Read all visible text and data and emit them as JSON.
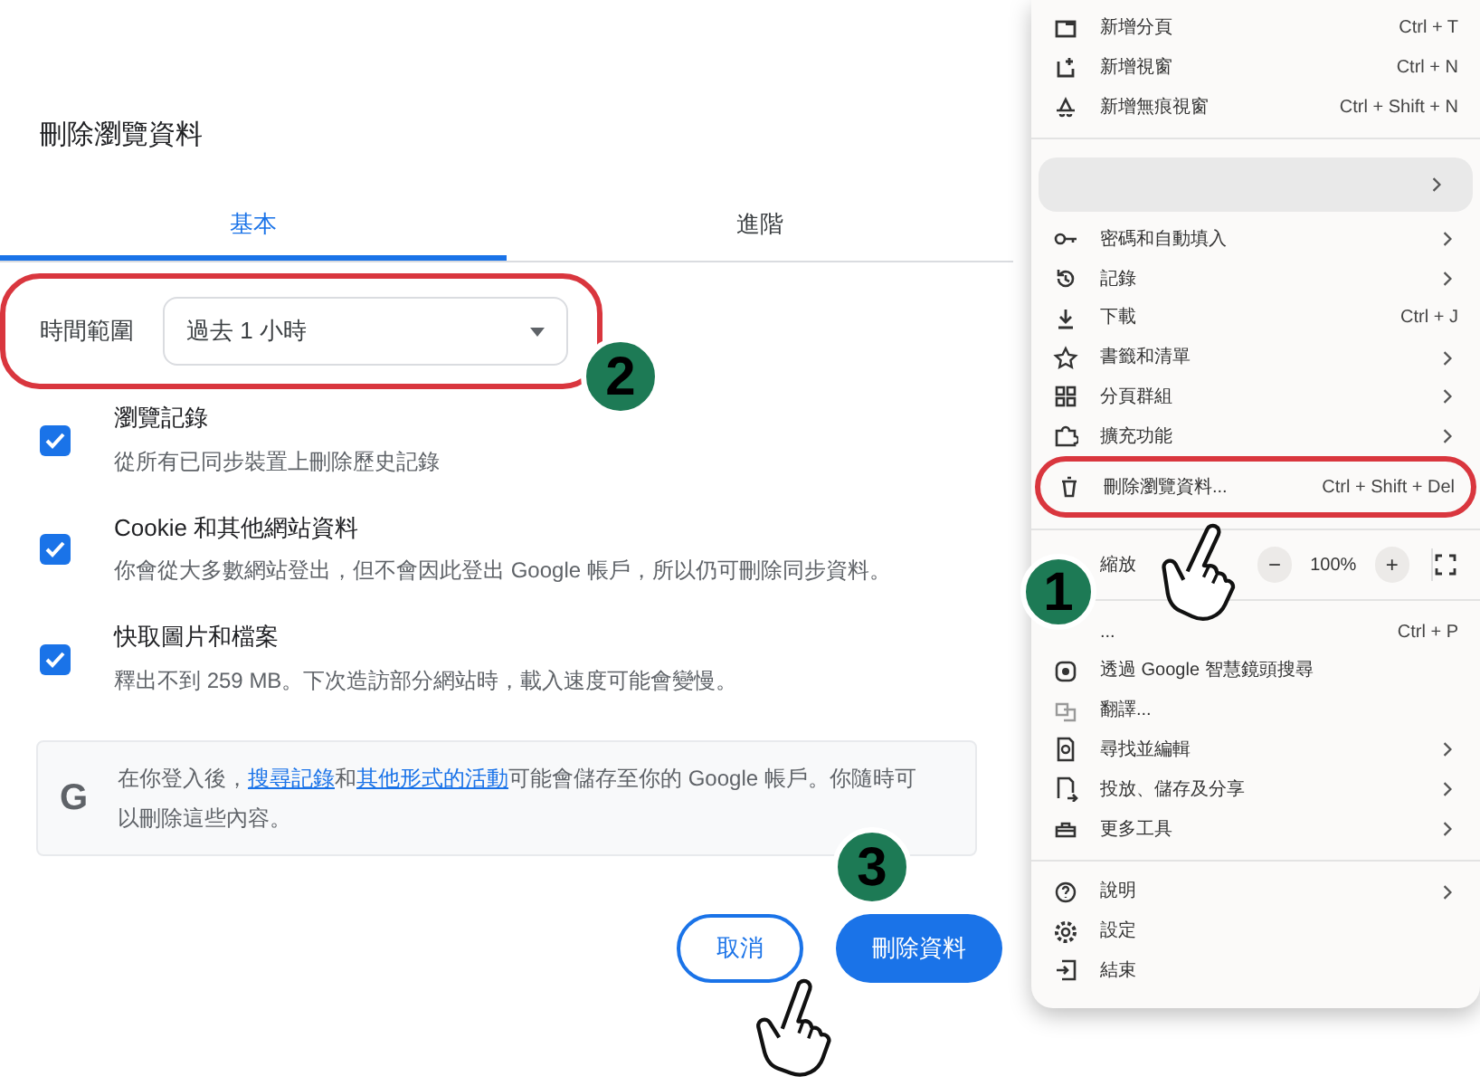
{
  "dialog": {
    "title": "刪除瀏覽資料",
    "tabs": [
      {
        "label": "基本",
        "selected": true
      },
      {
        "label": "進階",
        "selected": false
      }
    ],
    "time_range": {
      "label": "時間範圍",
      "value": "過去 1 小時",
      "highlighted": true
    },
    "options": [
      {
        "title": "瀏覽記錄",
        "description": "從所有已同步裝置上刪除歷史記錄",
        "checked": true
      },
      {
        "title": "Cookie 和其他網站資料",
        "description": "你會從大多數網站登出，但不會因此登出 Google 帳戶，所以仍可刪除同步資料。",
        "checked": true
      },
      {
        "title": "快取圖片和檔案",
        "description": "釋出不到 259 MB。下次造訪部分網站時，載入速度可能會變慢。",
        "checked": true
      }
    ],
    "info_logo": "G",
    "info": [
      {
        "kind": "text",
        "text": "在你登入後，"
      },
      {
        "kind": "link",
        "text": "搜尋記錄"
      },
      {
        "kind": "text",
        "text": "和"
      },
      {
        "kind": "link",
        "text": "其他形式的活動"
      },
      {
        "kind": "text",
        "text": "可能會儲存至你的 Google 帳戶。你隨時可以刪除這些內容。"
      }
    ],
    "buttons": [
      {
        "kind": "cancel",
        "label": "取消"
      },
      {
        "kind": "confirm",
        "label": "刪除資料"
      }
    ]
  },
  "menu": {
    "items": [
      {
        "kind": "item",
        "label": "新增分頁",
        "shortcut": "Ctrl + T",
        "submenu": false
      },
      {
        "kind": "item",
        "label": "新增視窗",
        "shortcut": "Ctrl + N",
        "submenu": false
      },
      {
        "kind": "item",
        "label": "新增無痕視窗",
        "shortcut": "Ctrl + Shift + N",
        "submenu": false
      },
      {
        "kind": "divider"
      },
      {
        "kind": "profile",
        "submenu": true
      },
      {
        "kind": "item",
        "label": "密碼和自動填入",
        "submenu": true
      },
      {
        "kind": "item",
        "label": "記錄",
        "submenu": true
      },
      {
        "kind": "item",
        "label": "下載",
        "shortcut": "Ctrl + J",
        "submenu": false
      },
      {
        "kind": "item",
        "label": "書籤和清單",
        "submenu": true
      },
      {
        "kind": "item",
        "label": "分頁群組",
        "submenu": true
      },
      {
        "kind": "item",
        "label": "擴充功能",
        "submenu": true
      },
      {
        "kind": "item",
        "label": "刪除瀏覽資料...",
        "shortcut": "Ctrl + Shift + Del",
        "submenu": false,
        "highlighted": true
      },
      {
        "kind": "divider"
      },
      {
        "kind": "zoom",
        "label": "縮放",
        "minus": "−",
        "value": "100%",
        "plus": "+"
      },
      {
        "kind": "divider"
      },
      {
        "kind": "item",
        "label": "...",
        "shortcut": "Ctrl + P",
        "submenu": false
      },
      {
        "kind": "item",
        "label": "透過 Google 智慧鏡頭搜尋",
        "submenu": false
      },
      {
        "kind": "item",
        "label": "翻譯...",
        "submenu": false
      },
      {
        "kind": "item",
        "label": "尋找並編輯",
        "submenu": true
      },
      {
        "kind": "item",
        "label": "投放、儲存及分享",
        "submenu": true
      },
      {
        "kind": "item",
        "label": "更多工具",
        "submenu": true
      },
      {
        "kind": "divider"
      },
      {
        "kind": "item",
        "label": "說明",
        "submenu": true
      },
      {
        "kind": "item",
        "label": "設定",
        "submenu": false
      },
      {
        "kind": "item",
        "label": "結束",
        "submenu": false
      }
    ]
  },
  "steps": [
    {
      "number": "1"
    },
    {
      "number": "2"
    },
    {
      "number": "3"
    }
  ]
}
